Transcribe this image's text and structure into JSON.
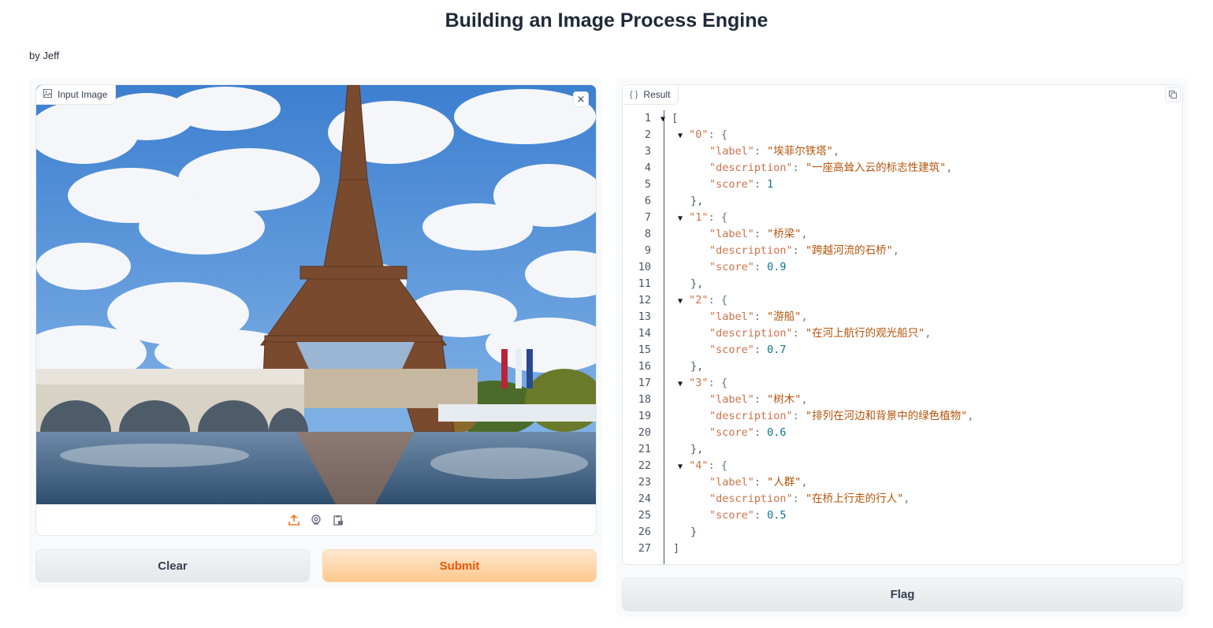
{
  "page": {
    "title": "Building an Image Process Engine",
    "byline": "by Jeff"
  },
  "input": {
    "label": "Input Image",
    "clear_symbol": "×",
    "tools": [
      "upload-icon",
      "webcam-icon",
      "clipboard-icon"
    ]
  },
  "buttons": {
    "clear": "Clear",
    "submit": "Submit",
    "flag": "Flag"
  },
  "result": {
    "label": "Result",
    "lines": [
      {
        "n": "1",
        "t": "["
      },
      {
        "n": "2",
        "t": "\"0\": {"
      },
      {
        "n": "3",
        "t": "\"label\": \"埃菲尔铁塔\","
      },
      {
        "n": "4",
        "t": "\"description\": \"一座高耸入云的标志性建筑\","
      },
      {
        "n": "5",
        "t": "\"score\": 1"
      },
      {
        "n": "6",
        "t": "},"
      },
      {
        "n": "7",
        "t": "\"1\": {"
      },
      {
        "n": "8",
        "t": "\"label\": \"桥梁\","
      },
      {
        "n": "9",
        "t": "\"description\": \"跨越河流的石桥\","
      },
      {
        "n": "10",
        "t": "\"score\": 0.9"
      },
      {
        "n": "11",
        "t": "},"
      },
      {
        "n": "12",
        "t": "\"2\": {"
      },
      {
        "n": "13",
        "t": "\"label\": \"游船\","
      },
      {
        "n": "14",
        "t": "\"description\": \"在河上航行的观光船只\","
      },
      {
        "n": "15",
        "t": "\"score\": 0.7"
      },
      {
        "n": "16",
        "t": "},"
      },
      {
        "n": "17",
        "t": "\"3\": {"
      },
      {
        "n": "18",
        "t": "\"label\": \"树木\","
      },
      {
        "n": "19",
        "t": "\"description\": \"排列在河边和背景中的绿色植物\","
      },
      {
        "n": "20",
        "t": "\"score\": 0.6"
      },
      {
        "n": "21",
        "t": "},"
      },
      {
        "n": "22",
        "t": "\"4\": {"
      },
      {
        "n": "23",
        "t": "\"label\": \"人群\","
      },
      {
        "n": "24",
        "t": "\"description\": \"在桥上行走的行人\","
      },
      {
        "n": "25",
        "t": "\"score\": 0.5"
      },
      {
        "n": "26",
        "t": "}"
      },
      {
        "n": "27",
        "t": "]"
      }
    ]
  },
  "colors": {
    "accent": "#f97316",
    "submit_text": "#ea580c"
  }
}
